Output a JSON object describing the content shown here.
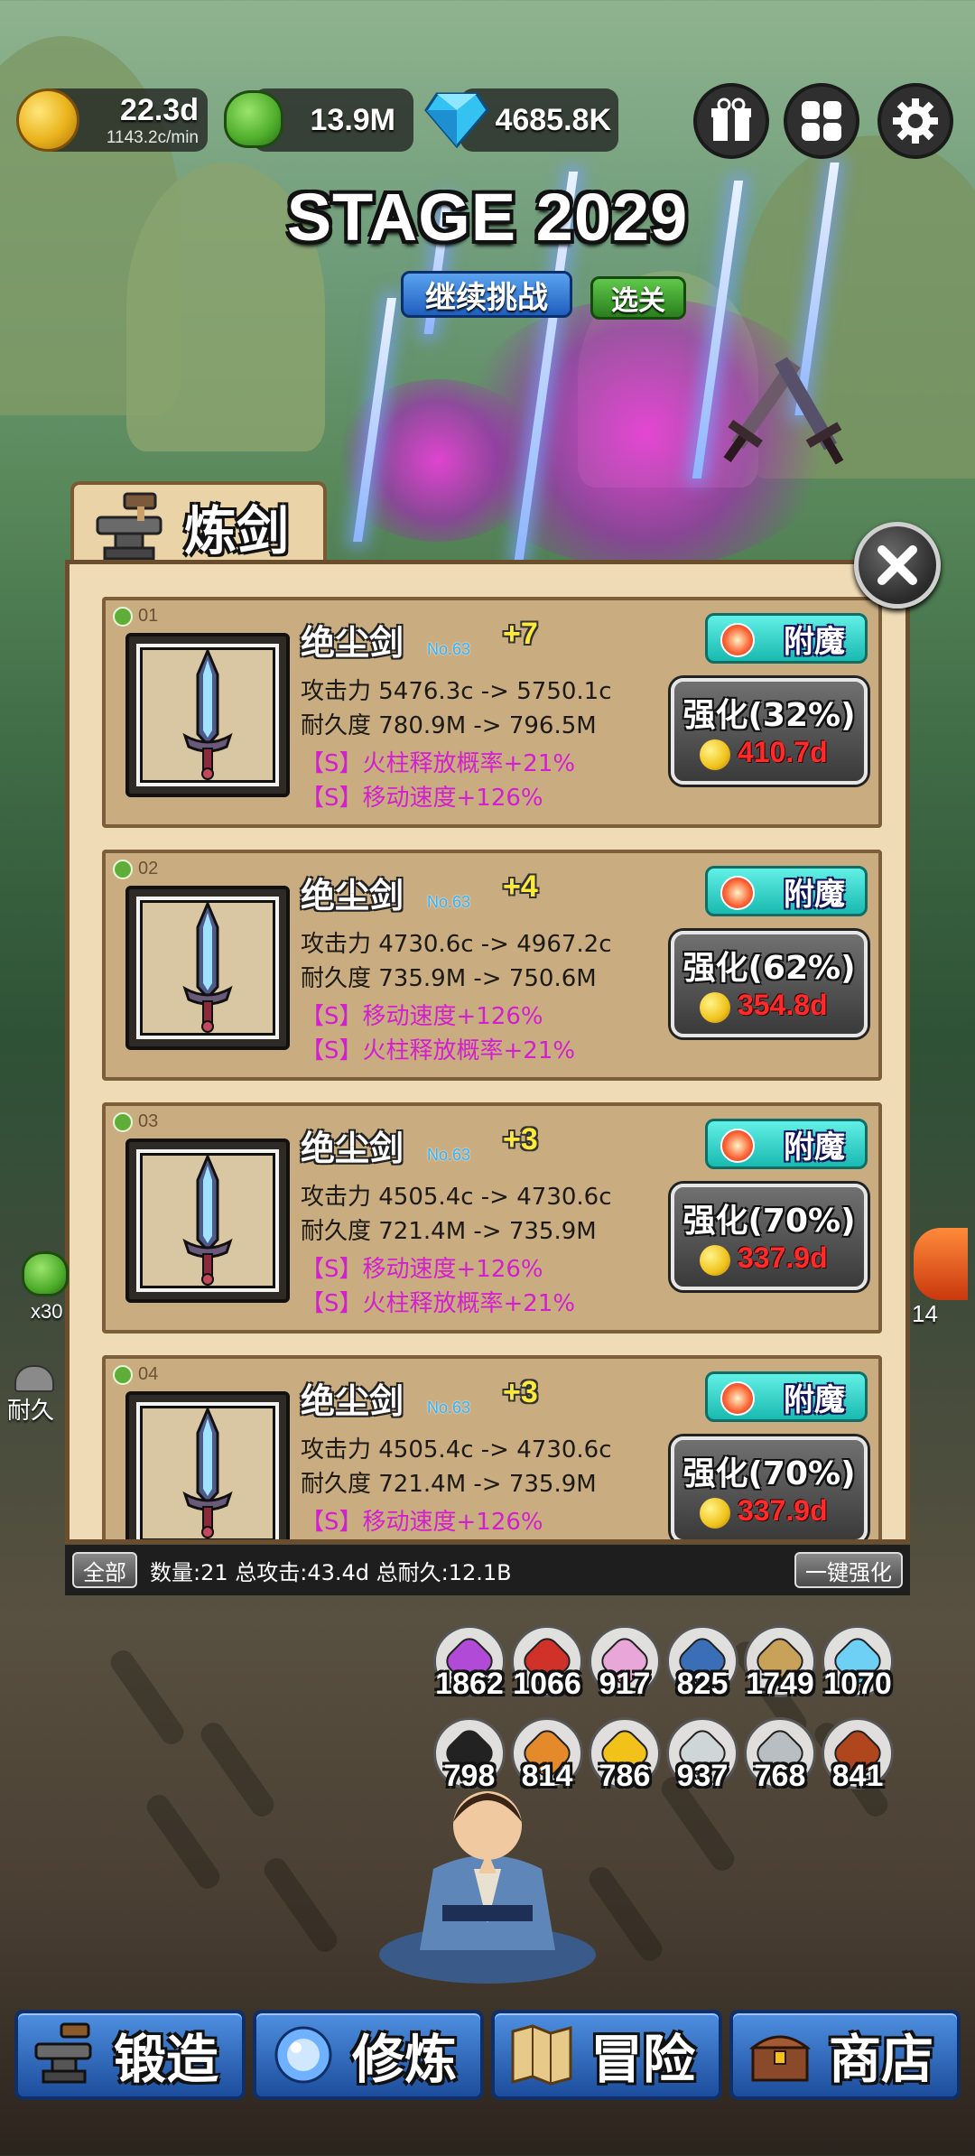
{
  "colors": {
    "panel_bg": "#efdcb6",
    "bonus_text": "#d21fcf",
    "cost_text": "#ff2a2a",
    "level_plus": "#ffe93a",
    "no_tag": "#2fb3ff",
    "nav_blue": "#1c4d9c"
  },
  "currency": {
    "gold": {
      "value": "22.3d",
      "rate": "1143.2c/min",
      "icon": "gold-coin-icon"
    },
    "slime": {
      "value": "13.9M",
      "icon": "green-slime-icon"
    },
    "gem": {
      "value": "4685.8K",
      "icon": "diamond-icon"
    }
  },
  "top_buttons": [
    "gift-icon",
    "grid-menu-icon",
    "gear-icon"
  ],
  "stage": {
    "title": "STAGE 2029",
    "continue_label": "继续挑战",
    "select_label": "选关"
  },
  "panel": {
    "title": "炼剑",
    "items": [
      {
        "num": "01",
        "name": "绝尘剑",
        "no": "No.63",
        "level": "+7",
        "atk": "攻击力 5476.3c -> 5750.1c",
        "dur": "耐久度 780.9M -> 796.5M",
        "bonus1": "【S】火柱释放概率+21%",
        "bonus2": "【S】移动速度+126%",
        "enchant": "附魔",
        "upgrade": "强化(32%)",
        "cost": "410.7d"
      },
      {
        "num": "02",
        "name": "绝尘剑",
        "no": "No.63",
        "level": "+4",
        "atk": "攻击力 4730.6c -> 4967.2c",
        "dur": "耐久度 735.9M -> 750.6M",
        "bonus1": "【S】移动速度+126%",
        "bonus2": "【S】火柱释放概率+21%",
        "enchant": "附魔",
        "upgrade": "强化(62%)",
        "cost": "354.8d"
      },
      {
        "num": "03",
        "name": "绝尘剑",
        "no": "No.63",
        "level": "+3",
        "atk": "攻击力 4505.4c -> 4730.6c",
        "dur": "耐久度 721.4M -> 735.9M",
        "bonus1": "【S】移动速度+126%",
        "bonus2": "【S】火柱释放概率+21%",
        "enchant": "附魔",
        "upgrade": "强化(70%)",
        "cost": "337.9d"
      },
      {
        "num": "04",
        "name": "绝尘剑",
        "no": "No.63",
        "level": "+3",
        "atk": "攻击力 4505.4c -> 4730.6c",
        "dur": "耐久度 721.4M -> 735.9M",
        "bonus1": "【S】移动速度+126%",
        "bonus2": "",
        "enchant": "附魔",
        "upgrade": "强化(70%)",
        "cost": "337.9d"
      }
    ],
    "filter_label": "全部",
    "summary": "数量:21 总攻击:43.4d 总耐久:12.1B",
    "upgrade_all_label": "一键强化"
  },
  "side": {
    "slime_count": "x30",
    "durability_label": "耐久",
    "right_count": "14"
  },
  "materials": {
    "row1": [
      {
        "icon": "purple-crystal-icon",
        "count": "1862",
        "color": "#b24ad8"
      },
      {
        "icon": "red-coral-icon",
        "count": "1066",
        "color": "#d0322a"
      },
      {
        "icon": "rainbow-crystal-icon",
        "count": "917",
        "color": "#e8a7d8"
      },
      {
        "icon": "blue-star-icon",
        "count": "825",
        "color": "#3a6fb8"
      },
      {
        "icon": "fossil-skull-icon",
        "count": "1749",
        "color": "#c9a25a"
      },
      {
        "icon": "ice-crystal-icon",
        "count": "1070",
        "color": "#6fd0f5"
      }
    ],
    "row2": [
      {
        "icon": "black-stone-icon",
        "count": "798",
        "color": "#222222"
      },
      {
        "icon": "amber-crystal-icon",
        "count": "814",
        "color": "#e48a2a"
      },
      {
        "icon": "gold-ore-icon",
        "count": "786",
        "color": "#f2c21a"
      },
      {
        "icon": "silver-coin-icon",
        "count": "937",
        "color": "#cfd6d8"
      },
      {
        "icon": "silver-ore-icon",
        "count": "768",
        "color": "#b9bec2"
      },
      {
        "icon": "red-ore-icon",
        "count": "841",
        "color": "#b0461e"
      }
    ]
  },
  "nav": [
    {
      "label": "锻造",
      "icon": "anvil-icon"
    },
    {
      "label": "修炼",
      "icon": "orb-icon"
    },
    {
      "label": "冒险",
      "icon": "map-icon"
    },
    {
      "label": "商店",
      "icon": "treasure-chest-icon"
    }
  ]
}
